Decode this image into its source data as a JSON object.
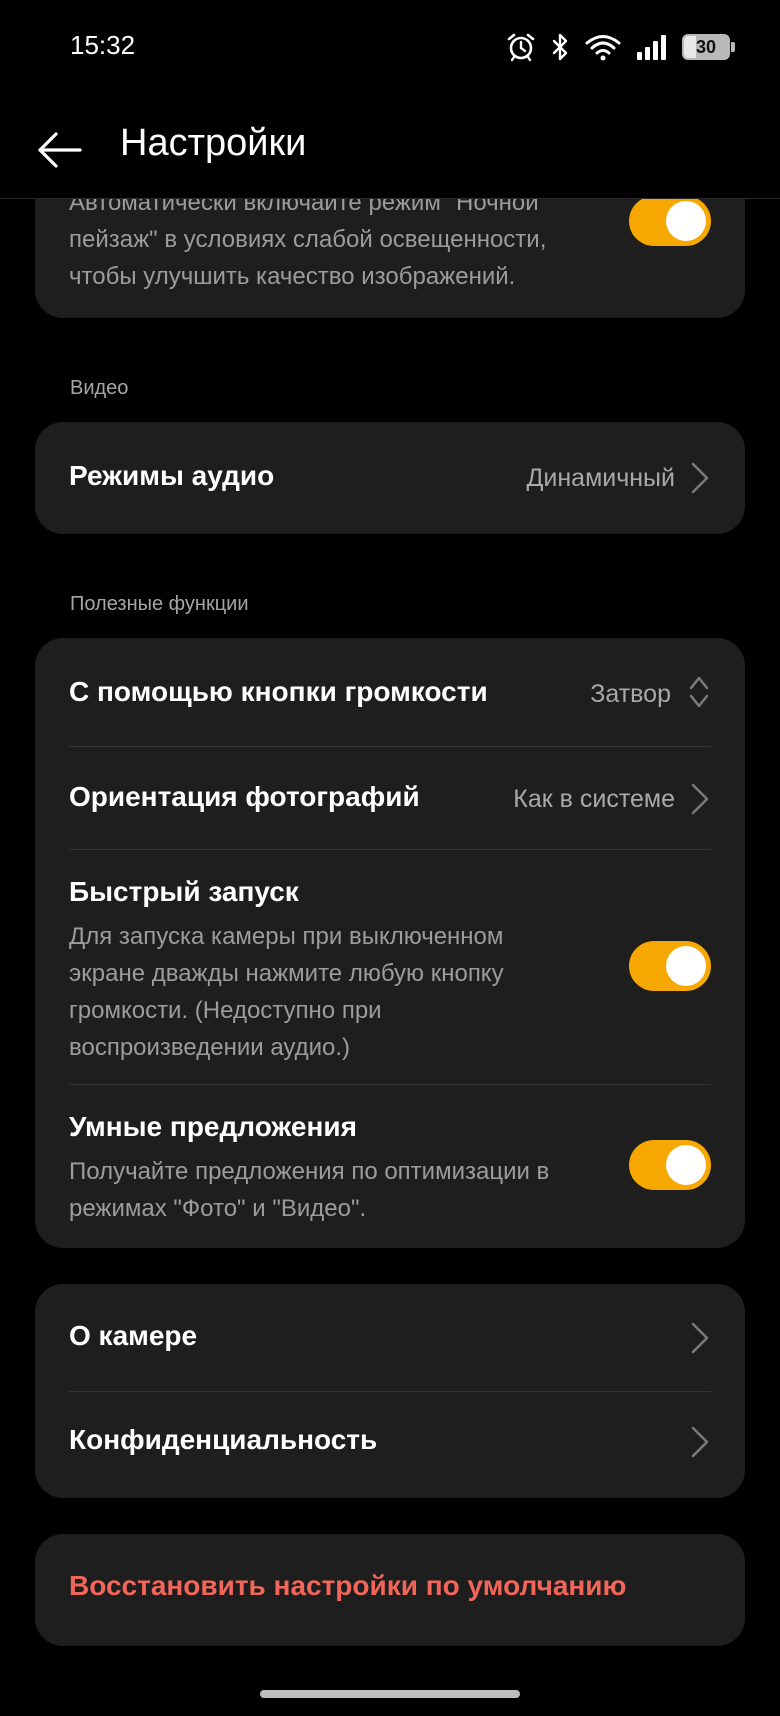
{
  "status_bar": {
    "time": "15:32",
    "battery_level": "30",
    "icons": [
      "alarm-icon",
      "bluetooth-icon",
      "wifi-icon",
      "signal-icon",
      "battery-icon"
    ]
  },
  "header": {
    "title": "Настройки",
    "back_icon": "arrow-left-icon"
  },
  "night_card": {
    "description": "Автоматически включайте режим \"Ночной пейзаж\" в условиях слабой освещенности, чтобы улучшить качество изображений.",
    "toggle_on": true
  },
  "video_section": {
    "header": "Видео",
    "audio_modes": {
      "label": "Режимы аудио",
      "value": "Динамичный"
    }
  },
  "useful_section": {
    "header": "Полезные функции",
    "volume_button": {
      "label": "С помощью кнопки громкости",
      "value": "Затвор"
    },
    "photo_orientation": {
      "label": "Ориентация фотографий",
      "value": "Как в системе"
    },
    "quick_launch": {
      "label": "Быстрый запуск",
      "description": "Для запуска камеры при выключенном экране дважды нажмите любую кнопку громкости. (Недоступно при воспроизведении аудио.)",
      "toggle_on": true
    },
    "smart_suggestions": {
      "label": "Умные предложения",
      "description": "Получайте предложения по оптимизации в режимах \"Фото\" и \"Видео\".",
      "toggle_on": true
    }
  },
  "about_section": {
    "about_camera": "О камере",
    "privacy": "Конфиденциальность"
  },
  "reset": {
    "label": "Восстановить настройки по умолчанию"
  },
  "colors": {
    "background": "#000000",
    "card": "#1e1e1e",
    "toggle_accent": "#f7a800",
    "reset_text": "#f2665a",
    "secondary_text": "#a9a9a9"
  }
}
